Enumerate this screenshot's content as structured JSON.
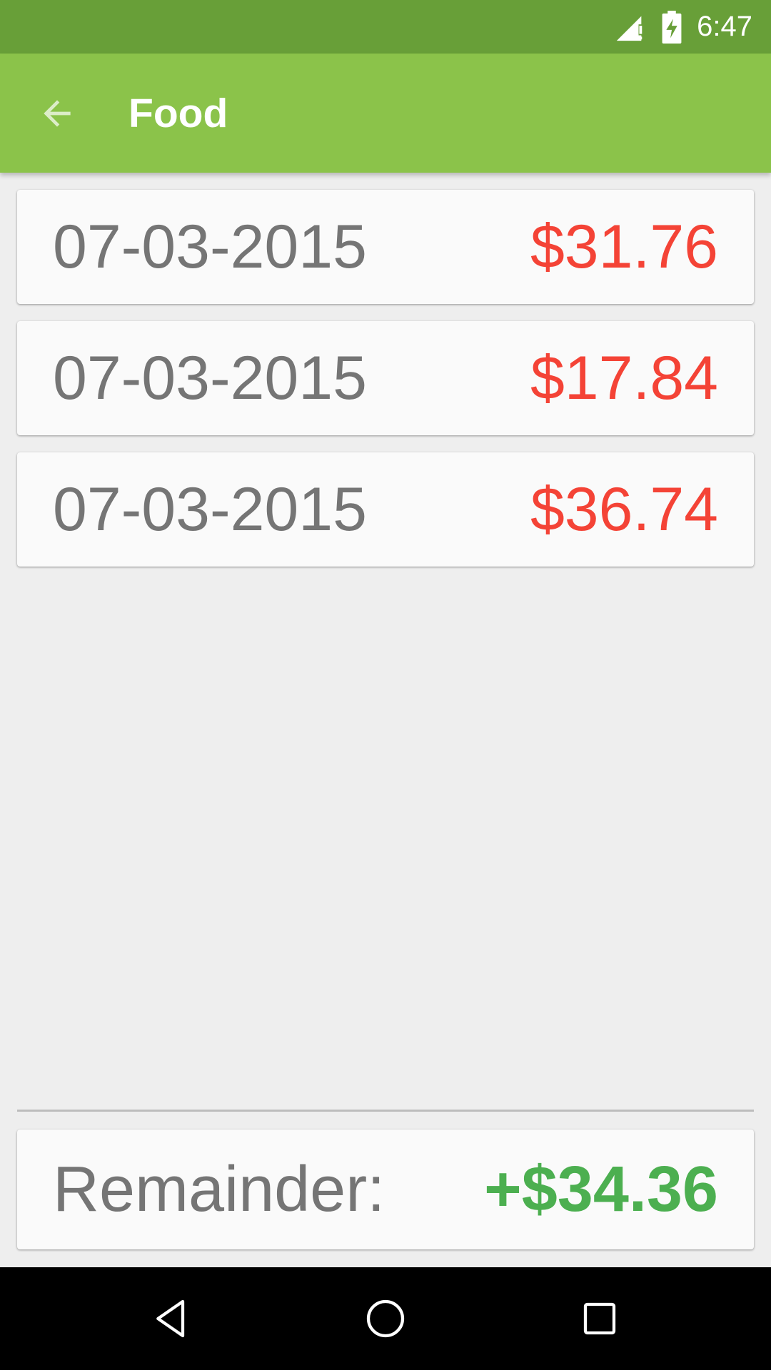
{
  "status_bar": {
    "time": "6:47",
    "icons": [
      "signal-no-data-icon",
      "battery-charging-icon"
    ]
  },
  "app_bar": {
    "title": "Food",
    "back_icon": "arrow-back-icon"
  },
  "entries": [
    {
      "date": "07-03-2015",
      "amount": "$31.76"
    },
    {
      "date": "07-03-2015",
      "amount": "$17.84"
    },
    {
      "date": "07-03-2015",
      "amount": "$36.74"
    }
  ],
  "summary": {
    "label": "Remainder:",
    "value": "+$34.36"
  },
  "nav_bar": {
    "icons": [
      "back-triangle-icon",
      "home-circle-icon",
      "recents-square-icon"
    ]
  },
  "colors": {
    "status_bar": "#689f38",
    "app_bar": "#8bc34a",
    "background": "#eeeeee",
    "amount": "#f44336",
    "remainder": "#4caf50",
    "date_text": "#757575"
  }
}
